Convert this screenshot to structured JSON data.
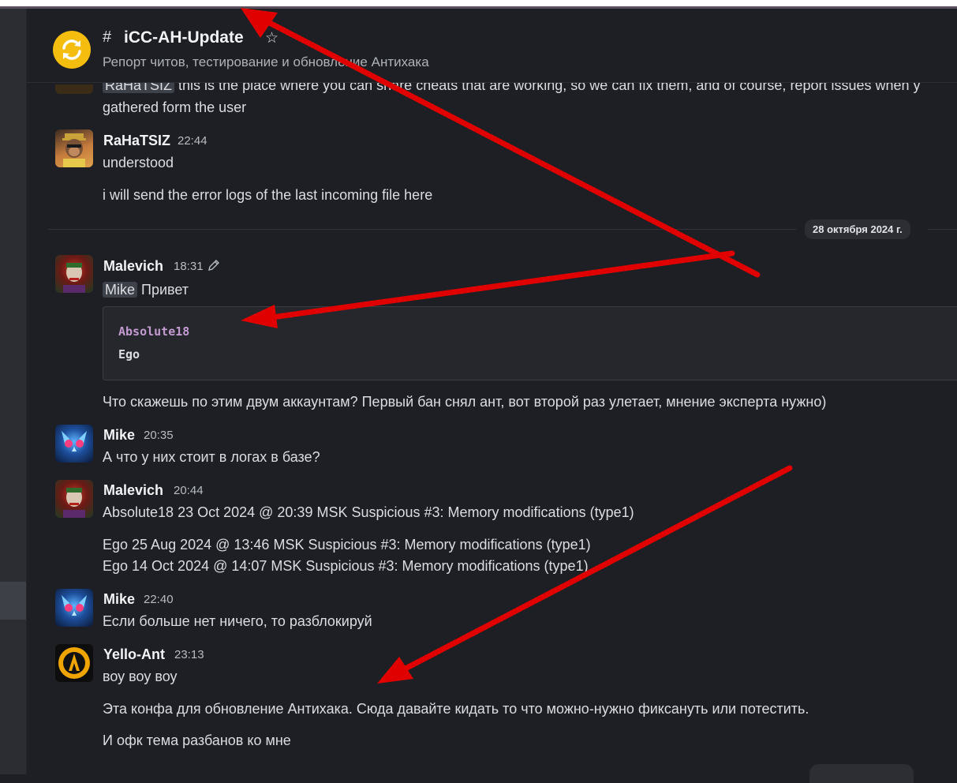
{
  "header": {
    "channel_title": "iCC-AH-Update",
    "channel_description": "Репорт читов, тестирование и обновление Антихака"
  },
  "messages": {
    "m0": {
      "mention": "RaHaTSIZ",
      "line1": " this is the place where you can share cheats that are working, so we can fix them, and of course, report issues when y",
      "line2": "gathered form the user"
    },
    "m1": {
      "author": "RaHaTSIZ",
      "time": "22:44",
      "line1": "understood",
      "line2": "i will send the error logs of the last incoming file here"
    },
    "m2": {
      "author": "Malevich",
      "time": "18:31",
      "mention": "Mike",
      "text": " Привет",
      "quote_line1": "Absolute18",
      "quote_line2": "Ego",
      "followup": "Что скажешь по этим двум аккаунтам? Первый бан снял ант, вот второй раз улетает, мнение эксперта нужно)"
    },
    "m3": {
      "author": "Mike",
      "time": "20:35",
      "text": "А что у них стоит в логах в базе?"
    },
    "m4": {
      "author": "Malevich",
      "time": "20:44",
      "line1": "Absolute18 23 Oct 2024 @ 20:39 MSK Suspicious #3: Memory modifications (type1)",
      "line2": "Ego 25 Aug 2024 @ 13:46 MSK Suspicious #3: Memory modifications (type1)",
      "line3": "Ego 14 Oct 2024 @ 14:07 MSK Suspicious #3: Memory modifications (type1)"
    },
    "m5": {
      "author": "Mike",
      "time": "22:40",
      "text": "Если больше нет ничего, то разблокируй"
    },
    "m6": {
      "author": "Yello-Ant",
      "time": "23:13",
      "line1": "воу воу воу",
      "line2": "Эта конфа для обновление Антихака. Сюда давайте кидать то что можно-нужно фиксануть или потестить.",
      "line3": "И офк тема разбанов ко мне"
    }
  },
  "date_divider": {
    "label": "28 октября 2024 г."
  },
  "colors": {
    "background": "#1e1f24",
    "annotation_arrow": "#e00000",
    "logo_yellow": "#f5bd0d",
    "quote_name": "#c49bd1"
  }
}
